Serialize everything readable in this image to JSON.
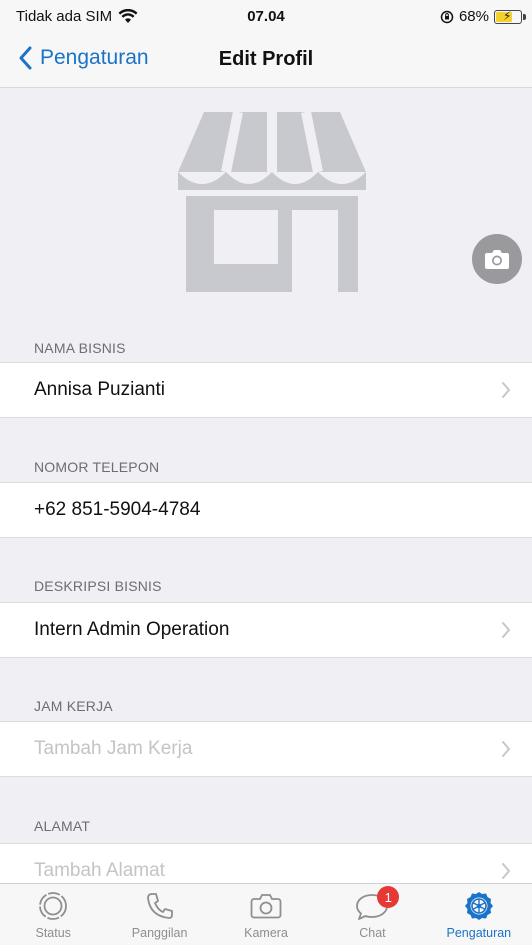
{
  "status_bar": {
    "carrier": "Tidak ada SIM",
    "time": "07.04",
    "battery_percent": "68%",
    "battery_level": 0.68
  },
  "nav": {
    "back_label": "Pengaturan",
    "title": "Edit Profil"
  },
  "icons": {
    "store": "store-icon",
    "camera": "camera-icon",
    "chevron": "chevron-right-icon"
  },
  "sections": [
    {
      "header": "NAMA BISNIS",
      "value": "Annisa Puzianti",
      "placeholder": false,
      "has_chevron": true
    },
    {
      "header": "NOMOR TELEPON",
      "value": "+62 851-5904-4784",
      "placeholder": false,
      "has_chevron": false
    },
    {
      "header": "DESKRIPSI BISNIS",
      "value": "Intern Admin Operation",
      "placeholder": false,
      "has_chevron": true
    },
    {
      "header": "JAM KERJA",
      "value": "Tambah Jam Kerja",
      "placeholder": true,
      "has_chevron": true
    },
    {
      "header": "ALAMAT",
      "value": "Tambah Alamat",
      "placeholder": true,
      "has_chevron": true
    }
  ],
  "tabs": [
    {
      "label": "Status",
      "icon": "status-icon"
    },
    {
      "label": "Panggilan",
      "icon": "phone-icon"
    },
    {
      "label": "Kamera",
      "icon": "camera-icon"
    },
    {
      "label": "Chat",
      "icon": "chat-icon",
      "badge": "1"
    },
    {
      "label": "Pengaturan",
      "icon": "settings-icon",
      "active": true
    }
  ],
  "colors": {
    "accent": "#1a73c8",
    "badge": "#e53935",
    "battery": "#f4d12d"
  }
}
